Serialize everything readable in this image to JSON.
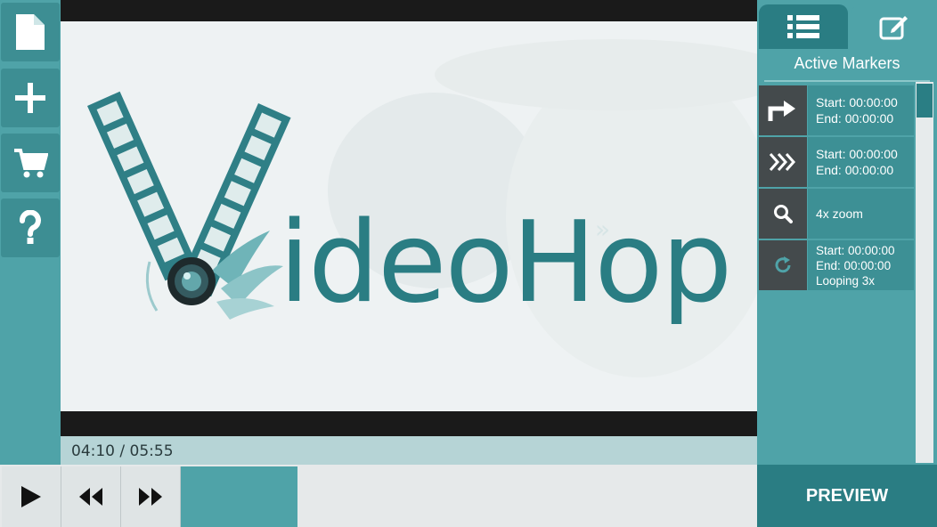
{
  "sidebar": {
    "items": [
      {
        "name": "new-file",
        "icon": "document-icon"
      },
      {
        "name": "add",
        "icon": "plus-icon"
      },
      {
        "name": "shop",
        "icon": "cart-icon"
      },
      {
        "name": "help",
        "icon": "question-icon"
      }
    ]
  },
  "video": {
    "logo_text": "ideoHop",
    "time": "04:10 / 05:55"
  },
  "controls": {
    "play": "play-icon",
    "rewind": "rewind-icon",
    "forward": "fast-forward-icon"
  },
  "panel": {
    "tabs": [
      {
        "name": "list-tab",
        "icon": "list-icon",
        "active": true
      },
      {
        "name": "edit-tab",
        "icon": "edit-icon",
        "active": false
      }
    ],
    "title": "Active Markers",
    "markers": [
      {
        "icon": "jump-arrow-icon",
        "lines": [
          "Start: 00:00:00",
          "End: 00:00:00"
        ]
      },
      {
        "icon": "fast-forward-chevrons-icon",
        "lines": [
          "Start: 00:00:00",
          "End: 00:00:00"
        ]
      },
      {
        "icon": "zoom-icon",
        "lines": [
          "4x zoom"
        ]
      },
      {
        "icon": "loop-icon",
        "lines": [
          "Start: 00:00:00",
          "End: 00:00:00",
          "Looping 3x"
        ]
      }
    ],
    "preview_label": "PREVIEW"
  },
  "colors": {
    "teal": "#4fa3a8",
    "dark_teal": "#2a7d83",
    "marker_icon_bg": "#444a4c"
  }
}
